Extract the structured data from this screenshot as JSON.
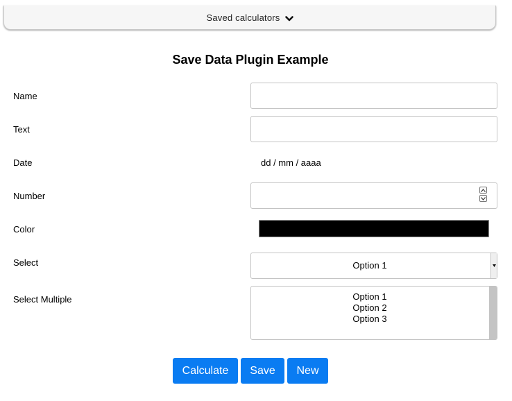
{
  "saved_bar": {
    "label": "Saved calculators",
    "icon": "chevron-down-icon"
  },
  "title": "Save Data Plugin Example",
  "fields": {
    "name": {
      "label": "Name",
      "value": ""
    },
    "text": {
      "label": "Text",
      "value": ""
    },
    "date": {
      "label": "Date",
      "placeholder": "dd / mm / aaaa"
    },
    "number": {
      "label": "Number",
      "value": ""
    },
    "color": {
      "label": "Color",
      "value": "#000000"
    },
    "select": {
      "label": "Select",
      "value": "Option 1"
    },
    "select_multiple": {
      "label": "Select Multiple",
      "options": [
        "Option 1",
        "Option 2",
        "Option 3"
      ]
    }
  },
  "buttons": {
    "calculate": "Calculate",
    "save": "Save",
    "new": "New"
  },
  "colors": {
    "button_bg": "#0a7cf2",
    "button_text": "#ffffff"
  }
}
